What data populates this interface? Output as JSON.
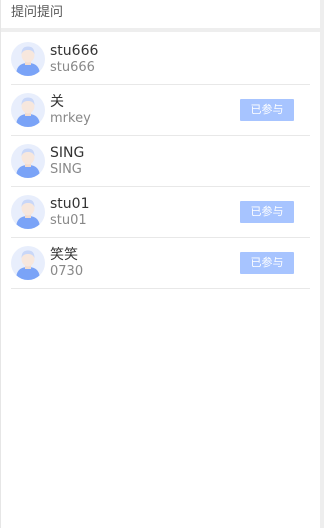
{
  "header": {
    "title": "提问提问"
  },
  "participants": [
    {
      "name": "stu666",
      "id": "stu666",
      "status": ""
    },
    {
      "name": "关",
      "id": "mrkey",
      "status": "已参与"
    },
    {
      "name": "SING",
      "id": "SING",
      "status": ""
    },
    {
      "name": "stu01",
      "id": "stu01",
      "status": "已参与"
    },
    {
      "name": "笑笑",
      "id": "0730",
      "status": "已参与"
    }
  ],
  "colors": {
    "badge": "#a7c4ff",
    "avatar_bg": "#e8eefc",
    "avatar_figure": "#7aa3f7"
  },
  "icons": {
    "avatar": "user-avatar-icon"
  }
}
